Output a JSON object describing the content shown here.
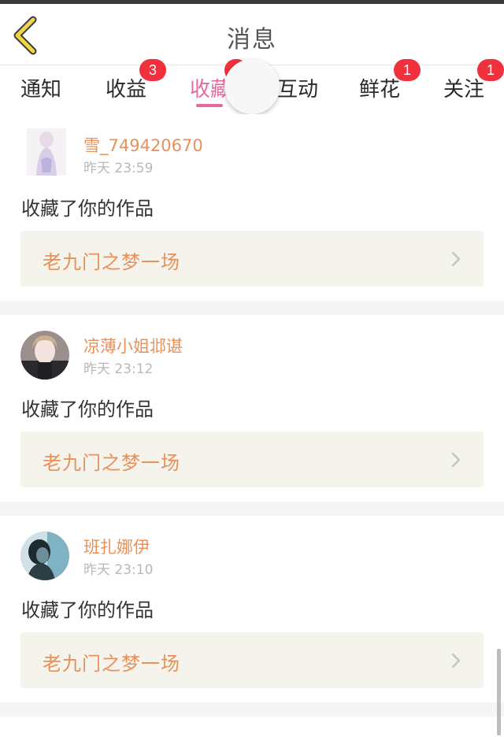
{
  "header": {
    "title": "消息"
  },
  "tabs": [
    {
      "label": "通知",
      "badge": ""
    },
    {
      "label": "收益",
      "badge": "3"
    },
    {
      "label": "收藏",
      "badge": "",
      "active": true
    },
    {
      "label": "互动",
      "badge": ""
    },
    {
      "label": "鲜花",
      "badge": "1"
    },
    {
      "label": "关注",
      "badge": "1"
    }
  ],
  "colors": {
    "accent": "#e46aa0",
    "badge": "#f0303c",
    "username": "#e8905a",
    "work_box_bg": "#f5f4ec"
  },
  "messages": [
    {
      "username": "雪_749420670",
      "time": "昨天 23:59",
      "action": "收藏了你的作品",
      "work_title": "老九门之梦一场"
    },
    {
      "username": "凉薄小姐邶谌",
      "time": "昨天 23:12",
      "action": "收藏了你的作品",
      "work_title": "老九门之梦一场"
    },
    {
      "username": "班扎娜伊",
      "time": "昨天 23:10",
      "action": "收藏了你的作品",
      "work_title": "老九门之梦一场"
    }
  ]
}
